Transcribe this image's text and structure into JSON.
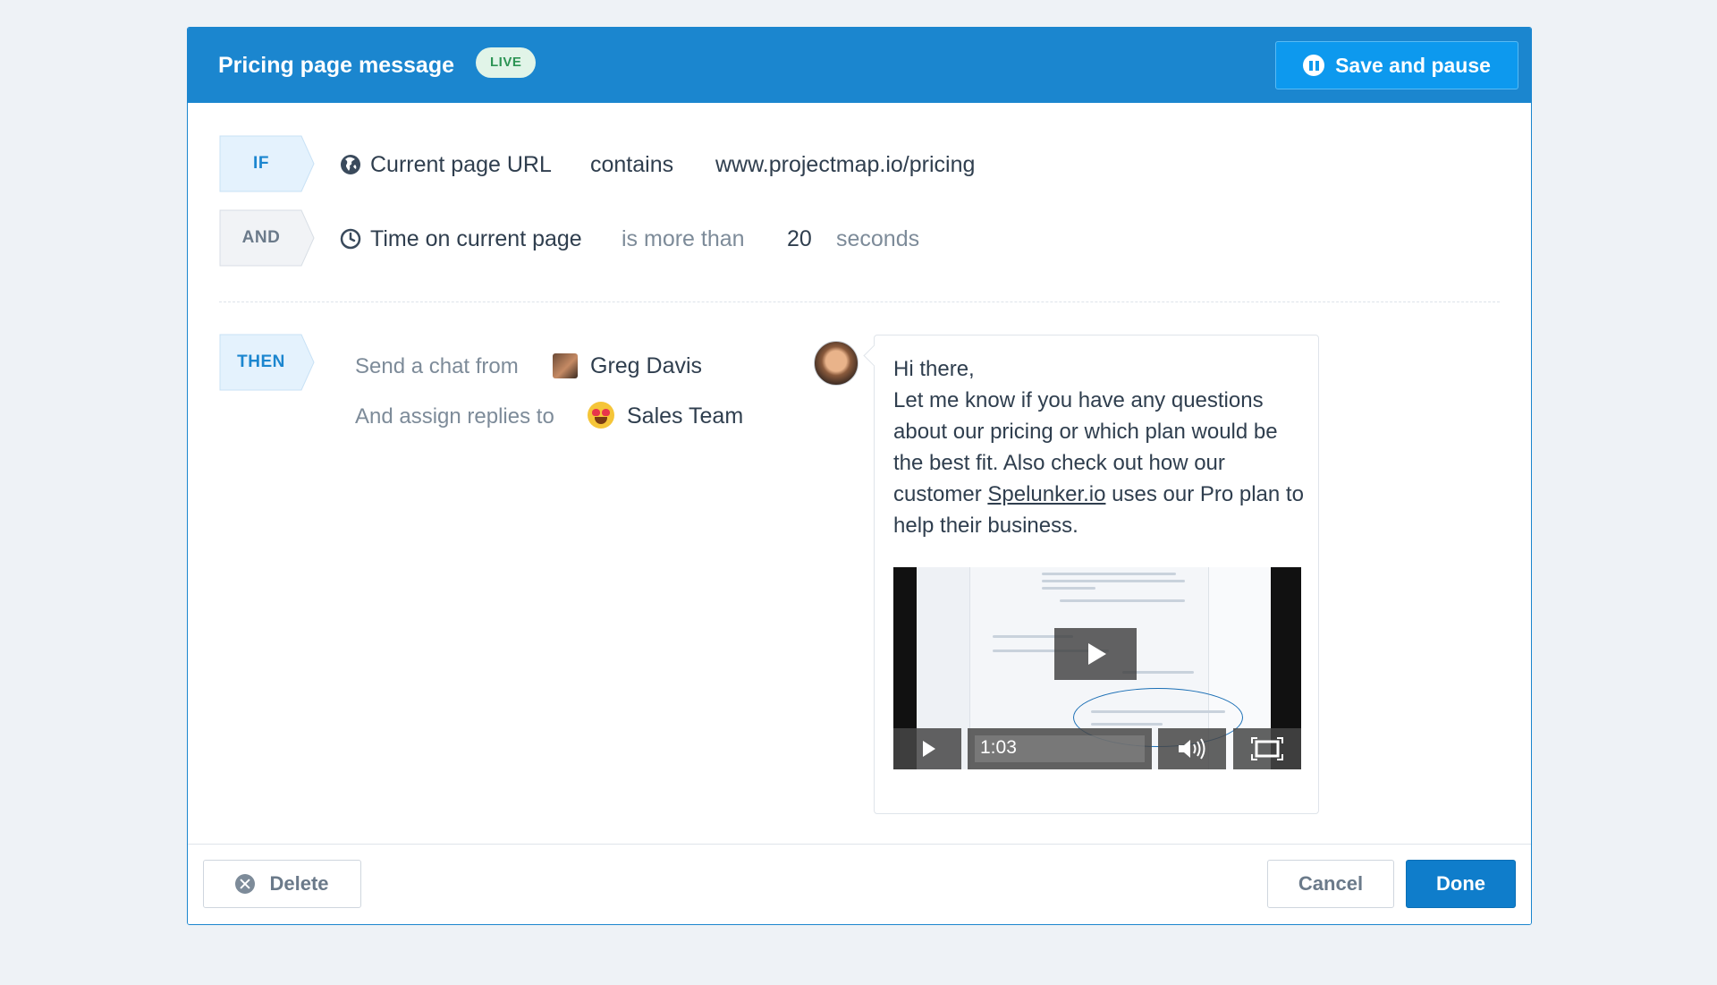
{
  "header": {
    "title": "Pricing page message",
    "status_badge": "LIVE",
    "save_pause_label": "Save and pause"
  },
  "rules": [
    {
      "tag": "IF",
      "attribute": "Current page URL",
      "operator": "contains",
      "value": "www.projectmap.io/pricing",
      "icon": "globe-icon"
    },
    {
      "tag": "AND",
      "attribute": "Time on current page",
      "operator": "is more than",
      "value": "20",
      "unit": "seconds",
      "icon": "clock-icon"
    }
  ],
  "then": {
    "tag": "THEN",
    "send_label": "Send a chat from",
    "sender": "Greg Davis",
    "assign_label": "And assign replies to",
    "assignee": "Sales Team"
  },
  "message": {
    "greeting": "Hi there,",
    "body_before_link": "Let me know if you have any questions about our pricing or which plan would be the best fit. Also check out how our customer ",
    "link_text": "Spelunker.io",
    "body_after_link": " uses our Pro plan to help their business.",
    "video": {
      "duration": "1:03"
    }
  },
  "footer": {
    "delete_label": "Delete",
    "cancel_label": "Cancel",
    "done_label": "Done"
  },
  "colors": {
    "header_bg": "#1b86cf",
    "primary_button": "#0f7dcb",
    "live_badge_bg": "#e1f4e8",
    "live_badge_text": "#2d9455"
  }
}
